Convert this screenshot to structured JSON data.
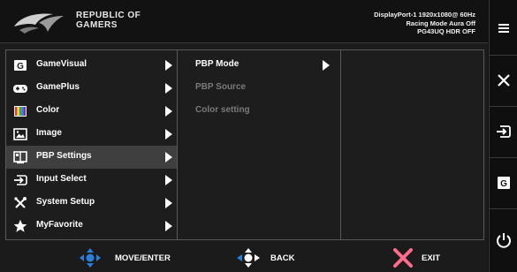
{
  "brand": {
    "line1": "REPUBLIC OF",
    "line2": "GAMERS",
    "logo_icon": "rog-eye-logo"
  },
  "status": {
    "line1": "DisplayPort-1 1920x1080@ 60Hz",
    "line2": "Racing Mode Aura Off",
    "line3": "PG43UQ HDR OFF"
  },
  "menu": {
    "items": [
      {
        "label": "GameVisual",
        "icon": "gamevisual-icon",
        "selected": false
      },
      {
        "label": "GamePlus",
        "icon": "gamepad-icon",
        "selected": false
      },
      {
        "label": "Color",
        "icon": "color-palette-icon",
        "selected": false
      },
      {
        "label": "Image",
        "icon": "image-icon",
        "selected": false
      },
      {
        "label": "PBP Settings",
        "icon": "pbp-icon",
        "selected": true
      },
      {
        "label": "Input Select",
        "icon": "input-select-icon",
        "selected": false
      },
      {
        "label": "System Setup",
        "icon": "tools-icon",
        "selected": false
      },
      {
        "label": "MyFavorite",
        "icon": "star-icon",
        "selected": false
      }
    ]
  },
  "submenu": {
    "items": [
      {
        "label": "PBP Mode",
        "enabled": true,
        "has_arrow": true
      },
      {
        "label": "PBP Source",
        "enabled": false,
        "has_arrow": false
      },
      {
        "label": "Color setting",
        "enabled": false,
        "has_arrow": false
      }
    ]
  },
  "footer": {
    "move": {
      "label": "MOVE/ENTER",
      "icon": "navigation-joystick-icon"
    },
    "back": {
      "label": "BACK",
      "icon": "back-joystick-icon"
    },
    "exit": {
      "label": "EXIT",
      "icon": "exit-x-icon"
    }
  },
  "sidebar": {
    "buttons": [
      {
        "icon": "menu-icon"
      },
      {
        "icon": "close-icon"
      },
      {
        "icon": "input-icon"
      },
      {
        "icon": "gamevisual-icon"
      },
      {
        "icon": "power-icon"
      }
    ]
  },
  "colors": {
    "accent_blue": "#2a7fd8",
    "exit_pink": "#ff6b8a",
    "selected_row": "#3f3f3f"
  }
}
